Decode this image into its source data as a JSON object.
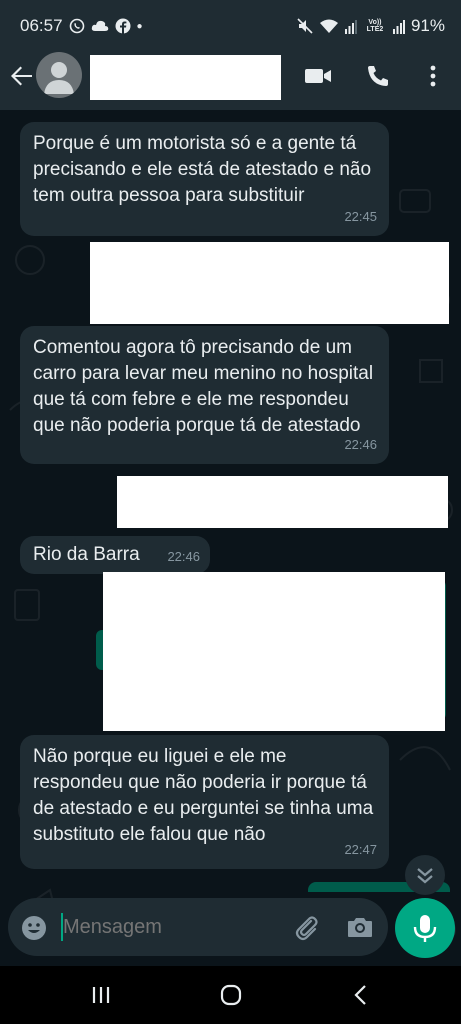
{
  "status_bar": {
    "time": "06:57",
    "battery": "91%",
    "left_icons": [
      "whatsapp-icon",
      "cloud-icon",
      "facebook-icon",
      "dot-icon"
    ],
    "right_icons": [
      "mute-icon",
      "wifi-icon",
      "signal-icon",
      "volte-icon",
      "signal-icon"
    ],
    "volte_label": "Vo)) LTE2"
  },
  "header": {
    "contact_name": "",
    "icons": [
      "back-arrow-icon",
      "avatar-icon",
      "video-call-icon",
      "phone-icon",
      "more-vert-icon"
    ]
  },
  "messages": [
    {
      "type": "incoming",
      "text": "Porque é um motorista só e a gente tá precisando e ele está de atestado e não tem outra pessoa para substituir",
      "time": "22:45"
    },
    {
      "type": "outgoing",
      "redacted": true
    },
    {
      "type": "incoming",
      "text": "Comentou agora tô precisando de um carro para levar meu menino no hospital que tá com febre e ele me respondeu que não poderia porque tá de atestado",
      "time": "22:46"
    },
    {
      "type": "outgoing",
      "redacted": true
    },
    {
      "type": "incoming",
      "text": "Rio da Barra",
      "time": "22:46"
    },
    {
      "type": "outgoing",
      "redacted": true
    },
    {
      "type": "incoming",
      "text": "Não porque eu liguei e ele me respondeu que não poderia ir porque tá de atestado e eu perguntei se tinha uma substituto ele falou que não",
      "time": "22:47"
    }
  ],
  "input": {
    "placeholder": "Mensagem",
    "icons": [
      "emoji-icon",
      "attach-icon",
      "camera-icon",
      "mic-icon"
    ]
  },
  "scroll_down_icon": "chevron-double-down-icon",
  "nav_bar": {
    "icons": [
      "recents-icon",
      "home-icon",
      "back-icon"
    ]
  },
  "colors": {
    "background": "#0b141a",
    "bubble_incoming": "#1f2c33",
    "bubble_outgoing": "#005c4b",
    "accent": "#00a884",
    "timestamp": "#8696a0"
  }
}
